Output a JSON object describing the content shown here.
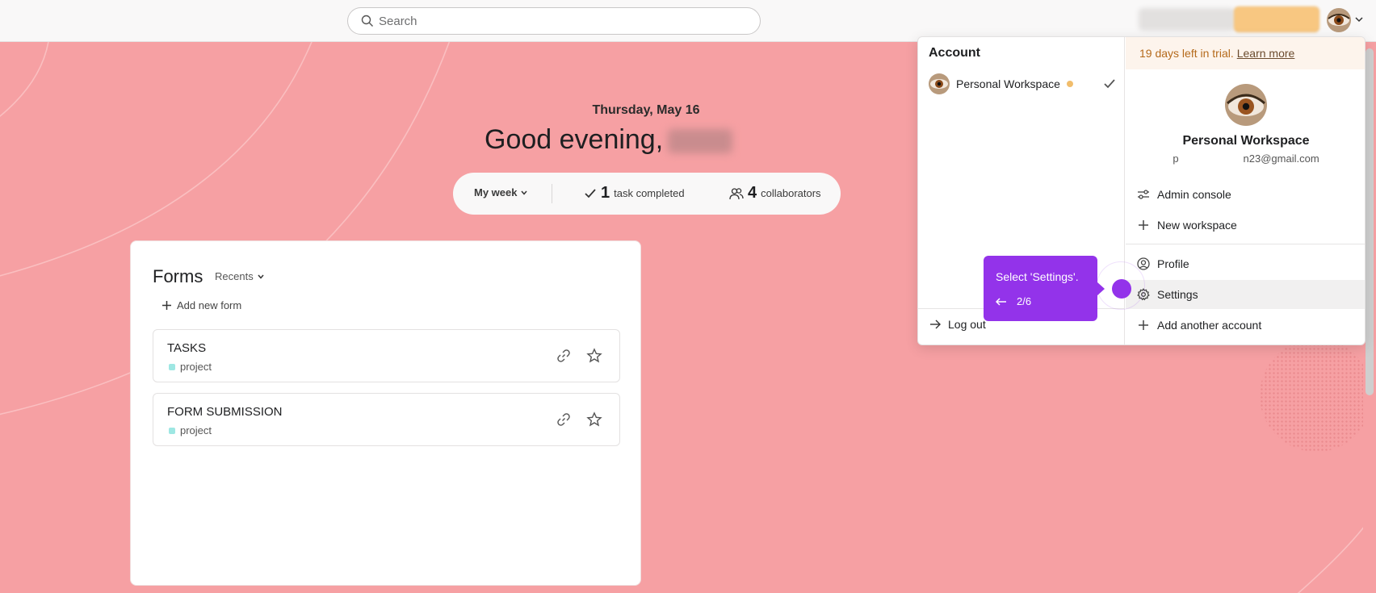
{
  "topbar": {
    "search_placeholder": "Search"
  },
  "hero": {
    "date": "Thursday, May 16",
    "greeting": "Good evening,"
  },
  "stats": {
    "period": "My week",
    "tasks_count": "1",
    "tasks_label": "task completed",
    "collab_count": "4",
    "collab_label": "collaborators"
  },
  "forms": {
    "title": "Forms",
    "filter": "Recents",
    "add_label": "Add new form",
    "items": [
      {
        "name": "TASKS",
        "tag": "project"
      },
      {
        "name": "FORM SUBMISSION",
        "tag": "project"
      }
    ],
    "tag_color": "#9ee7e3"
  },
  "account_menu": {
    "section_title": "Account",
    "workspace_name": "Personal Workspace",
    "logout": "Log out",
    "trial_text": "19 days left in trial.",
    "learn_more": "Learn more",
    "profile_name": "Personal Workspace",
    "email_prefix": "p",
    "email_suffix": "n23@gmail.com",
    "items": {
      "admin": "Admin console",
      "new_workspace": "New workspace",
      "profile": "Profile",
      "settings": "Settings",
      "add_account": "Add another account"
    }
  },
  "tooltip": {
    "text": "Select 'Settings'.",
    "step": "2/6",
    "color": "#9333ea"
  },
  "colors": {
    "background": "#f6a0a3",
    "trial_accent": "#f8c781"
  }
}
